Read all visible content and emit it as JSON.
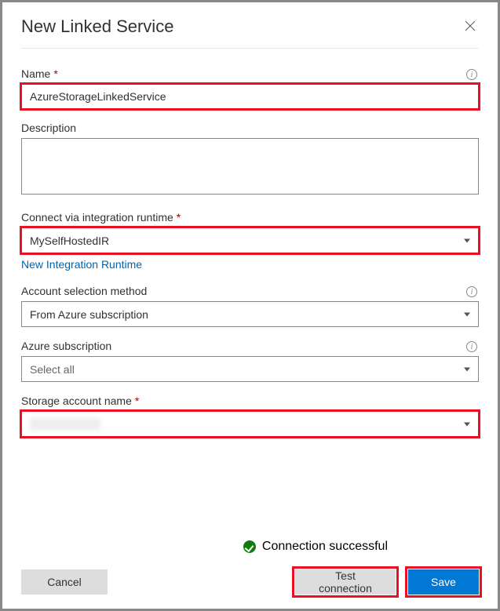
{
  "header": {
    "title": "New Linked Service"
  },
  "fields": {
    "name": {
      "label": "Name",
      "value": "AzureStorageLinkedService"
    },
    "description": {
      "label": "Description",
      "value": ""
    },
    "runtime": {
      "label": "Connect via integration runtime",
      "value": "MySelfHostedIR",
      "link": "New Integration Runtime"
    },
    "account_method": {
      "label": "Account selection method",
      "value": "From Azure subscription"
    },
    "subscription": {
      "label": "Azure subscription",
      "value": "Select all"
    },
    "storage_name": {
      "label": "Storage account name",
      "value": ""
    }
  },
  "status": {
    "text": "Connection successful"
  },
  "buttons": {
    "cancel": "Cancel",
    "test": "Test connection",
    "save": "Save"
  }
}
